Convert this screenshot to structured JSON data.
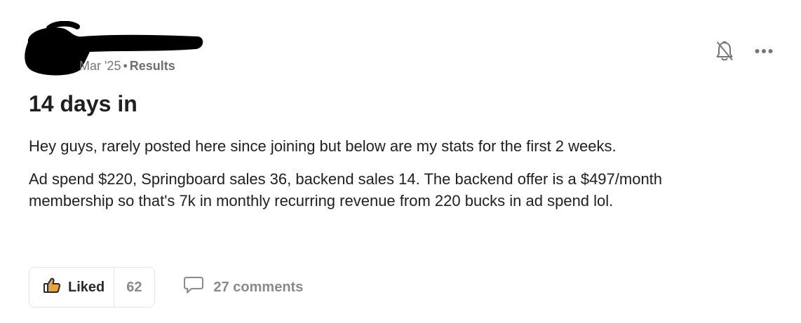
{
  "post": {
    "meta": {
      "date": "Mar '25",
      "separator": "•",
      "category": "Results"
    },
    "title": "14 days in",
    "paragraphs": [
      "Hey guys, rarely posted here since joining but below are my stats for the first 2 weeks.",
      "Ad spend $220, Springboard sales 36, backend sales 14. The backend offer is a $497/month membership so that's 7k in monthly recurring revenue from 220 bucks in ad spend lol."
    ],
    "actions": {
      "bell_icon": "bell-off-icon",
      "more_icon": "more-horizontal-icon"
    },
    "footer": {
      "like_label": "Liked",
      "like_count": "62",
      "comments_label": "27 comments",
      "like_icon": "thumbs-up-icon",
      "comment_icon": "comment-icon"
    }
  },
  "colors": {
    "text": "#1f1f1f",
    "muted": "#8a8a8a",
    "like_accent": "#e8a33a",
    "border": "#e4e4e4"
  }
}
